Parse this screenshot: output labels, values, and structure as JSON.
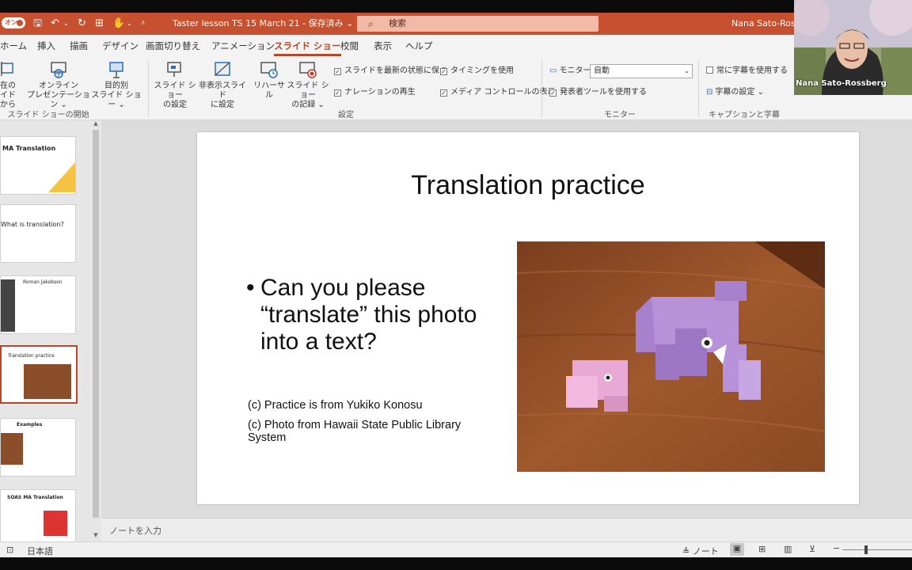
{
  "titlebar": {
    "autosave_label": "オン",
    "document_title": "Taster lesson TS 15 March 21 - 保存済み ⌄",
    "search_placeholder": "検索",
    "user_name": "Nana Sato-Rossb"
  },
  "tabs": [
    "ホーム",
    "挿入",
    "描画",
    "デザイン",
    "画面切り替え",
    "アニメーション",
    "スライド ショー",
    "校閲",
    "表示",
    "ヘルプ"
  ],
  "active_tab": "スライド ショー",
  "ribbon": {
    "btn_from_current_line1": "在の",
    "btn_from_current_line2": "イドから",
    "btn_online_line1": "オンライン",
    "btn_online_line2": "プレゼンテーション ⌄",
    "btn_custom_line1": "目的別",
    "btn_custom_line2": "スライド ショー ⌄",
    "group_start": "スライド ショーの開始",
    "btn_setup_line1": "スライド ショー",
    "btn_setup_line2": "の設定",
    "btn_hide_line1": "非表示スライド",
    "btn_hide_line2": "に設定",
    "btn_rehearse": "リハーサル",
    "btn_record_line1": "スライド ショー",
    "btn_record_line2": "の記録 ⌄",
    "chk_keep_updated": "スライドを最新の状態に保つ",
    "chk_narration": "ナレーションの再生",
    "chk_timings": "タイミングを使用",
    "chk_media_controls": "メディア コントロールの表示",
    "group_setup": "設定",
    "monitor_label": "モニター:",
    "monitor_value": "自動",
    "chk_presenter_view": "発表者ツールを使用する",
    "group_monitor": "モニター",
    "chk_always_captions": "常に字幕を使用する",
    "captions_settings": "字幕の設定 ⌄",
    "group_captions": "キャプションと字幕"
  },
  "webcam": {
    "name": "Nana Sato-Rossberg"
  },
  "thumbnails": {
    "t1_title": "MA Translation",
    "t2_title": "What is translation?",
    "t3_title": "Roman Jakobson",
    "t4_title": "Translation practice",
    "t5_title": "Examples",
    "t6_title": "SOAS MA Translation"
  },
  "slide": {
    "title": "Translation practice",
    "bullet": "Can you please “translate” this photo into a text?",
    "credit1": "(c) Practice is from Yukiko Konosu",
    "credit2": "(c) Photo from Hawaii State Public Library System"
  },
  "notes_placeholder": "ノートを入力",
  "statusbar": {
    "language": "日本語",
    "notes_button": "ノート"
  },
  "colors": {
    "accent": "#b7472a",
    "titlebar": "#c6502f"
  }
}
